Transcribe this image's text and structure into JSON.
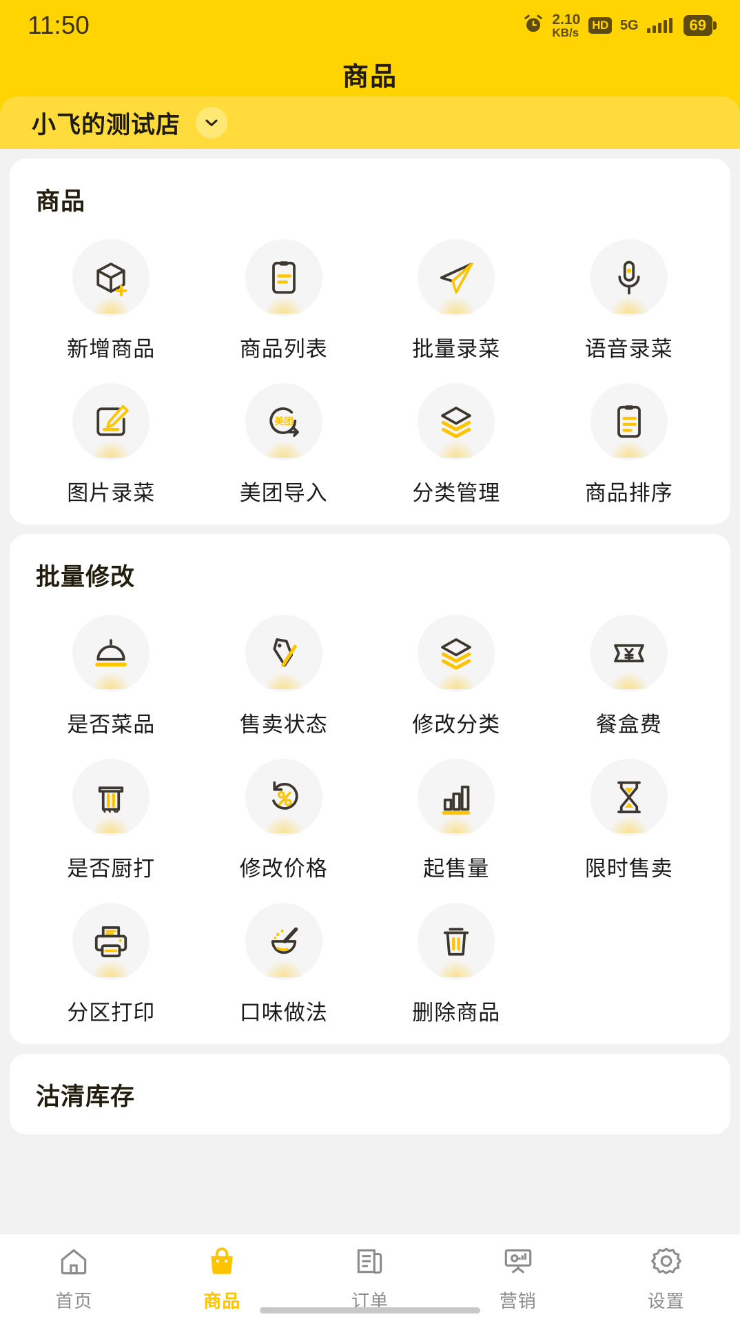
{
  "status_bar": {
    "time": "11:50",
    "net_speed_value": "2.10",
    "net_speed_unit": "KB/s",
    "hd_label": "HD",
    "network_label": "5G",
    "battery_level": "69"
  },
  "header": {
    "title": "商品"
  },
  "shop_selector": {
    "name": "小飞的测试店"
  },
  "theme": {
    "brand_yellow": "#FFD400",
    "shop_bar_yellow": "#FFDC3C",
    "accent_yellow": "#FFC400",
    "icon_dark": "#3c3830",
    "bubble_bg": "#f5f5f6",
    "page_bg": "#f2f2f2"
  },
  "sections": [
    {
      "title": "商品",
      "items": [
        {
          "label": "新增商品",
          "icon": "box-plus-icon"
        },
        {
          "label": "商品列表",
          "icon": "clipboard-list-icon"
        },
        {
          "label": "批量录菜",
          "icon": "paper-plane-icon"
        },
        {
          "label": "语音录菜",
          "icon": "microphone-icon"
        },
        {
          "label": "图片录菜",
          "icon": "image-edit-icon"
        },
        {
          "label": "美团导入",
          "icon": "meituan-import-icon"
        },
        {
          "label": "分类管理",
          "icon": "layers-icon"
        },
        {
          "label": "商品排序",
          "icon": "clipboard-sort-icon"
        }
      ]
    },
    {
      "title": "批量修改",
      "items": [
        {
          "label": "是否菜品",
          "icon": "food-cloche-icon"
        },
        {
          "label": "售卖状态",
          "icon": "tag-pen-icon"
        },
        {
          "label": "修改分类",
          "icon": "layers-icon"
        },
        {
          "label": "餐盒费",
          "icon": "yuan-ticket-icon"
        },
        {
          "label": "是否厨打",
          "icon": "kitchen-print-icon"
        },
        {
          "label": "修改价格",
          "icon": "percent-refresh-icon"
        },
        {
          "label": "起售量",
          "icon": "bar-chart-icon"
        },
        {
          "label": "限时售卖",
          "icon": "hourglass-icon"
        },
        {
          "label": "分区打印",
          "icon": "printer-icon"
        },
        {
          "label": "口味做法",
          "icon": "mortar-pestle-icon"
        },
        {
          "label": "删除商品",
          "icon": "trash-icon"
        }
      ]
    },
    {
      "title": "沽清库存",
      "items": []
    }
  ],
  "tabbar": {
    "items": [
      {
        "label": "首页",
        "icon": "home-icon",
        "active": false
      },
      {
        "label": "商品",
        "icon": "shopping-bag-icon",
        "active": true
      },
      {
        "label": "订单",
        "icon": "order-list-icon",
        "active": false
      },
      {
        "label": "营销",
        "icon": "marketing-board-icon",
        "active": false
      },
      {
        "label": "设置",
        "icon": "gear-icon",
        "active": false
      }
    ]
  }
}
